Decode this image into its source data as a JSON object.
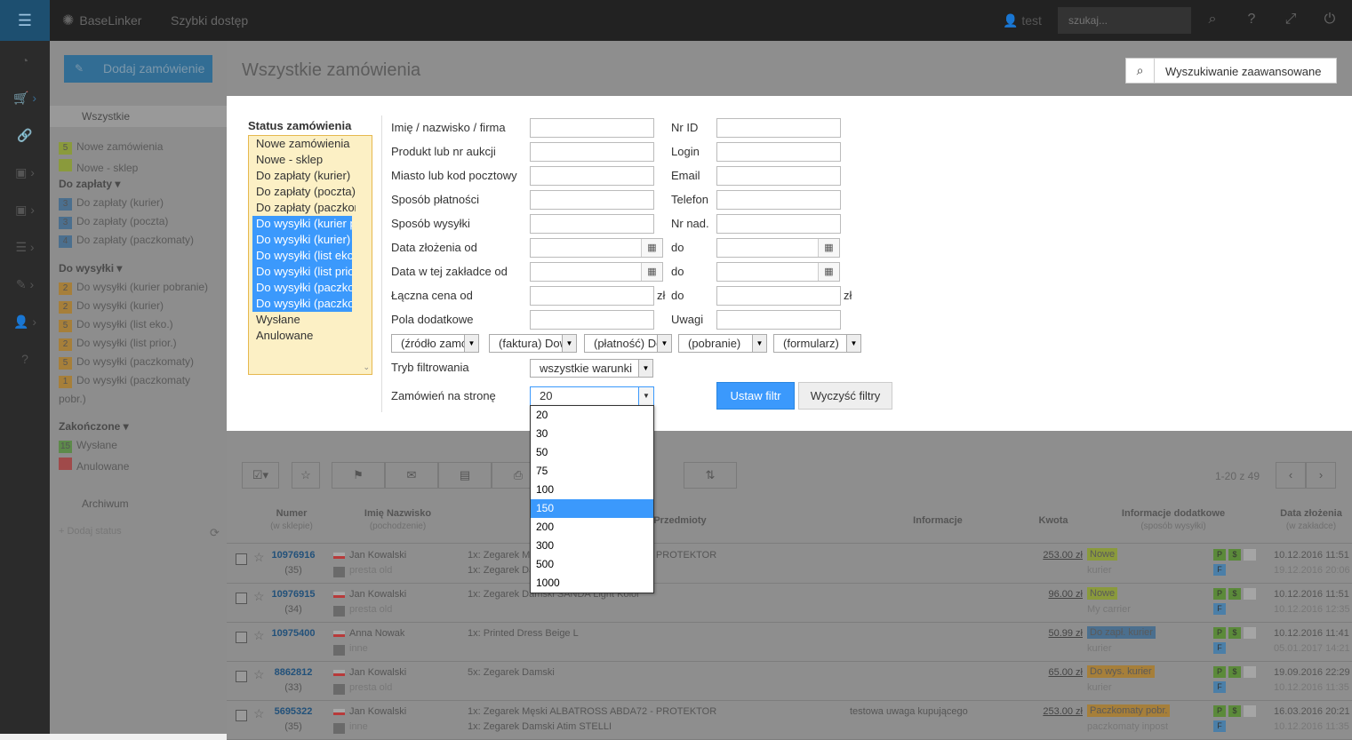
{
  "topbar": {
    "brand": "BaseLinker",
    "quick_access": "Szybki dostęp",
    "user": "test",
    "search_placeholder": "szukaj..."
  },
  "sidebar": {
    "add_order": "Dodaj zamówienie",
    "all": "Wszystkie",
    "items": [
      {
        "num": "5",
        "label": "Nowe zamówienia",
        "color": "#8a9a3c"
      },
      {
        "num": "",
        "label": "Nowe - sklep",
        "color": "#8a9a3c"
      },
      {
        "num": "3",
        "label": "Do zapłaty (kurier)",
        "color": "#4b6f8e"
      },
      {
        "num": "3",
        "label": "Do zapłaty (poczta)",
        "color": "#4b6f8e"
      },
      {
        "num": "4",
        "label": "Do zapłaty (paczkomaty)",
        "color": "#4b6f8e"
      },
      {
        "num": "2",
        "label": "Do wysyłki (kurier pobranie)",
        "color": "#a67f3a"
      },
      {
        "num": "2",
        "label": "Do wysyłki (kurier)",
        "color": "#a67f3a"
      },
      {
        "num": "5",
        "label": "Do wysyłki (list eko.)",
        "color": "#a67f3a"
      },
      {
        "num": "2",
        "label": "Do wysyłki (list prior.)",
        "color": "#a67f3a"
      },
      {
        "num": "5",
        "label": "Do wysyłki (paczkomaty)",
        "color": "#a67f3a"
      },
      {
        "num": "1",
        "label": "Do wysyłki (paczkomaty",
        "color": "#a67f3a"
      },
      {
        "num": "",
        "label": "pobr.)",
        "color": ""
      },
      {
        "num": "15",
        "label": "Wysłane",
        "color": "#5d8a4a"
      },
      {
        "num": "",
        "label": "Anulowane",
        "color": "#a04a4a"
      }
    ],
    "groups": [
      "Do zapłaty ▾",
      "Do wysyłki ▾",
      "Zakończone ▾"
    ],
    "archive": "Archiwum",
    "add_status": "+ Dodaj status"
  },
  "main": {
    "title": "Wszystkie zamówienia",
    "advanced_search": "Wyszukiwanie zaawansowane"
  },
  "filter": {
    "status_label": "Status zamówienia",
    "status_options": [
      {
        "label": "Nowe zamówienia",
        "selected": false
      },
      {
        "label": "Nowe - sklep",
        "selected": false
      },
      {
        "label": "Do zapłaty (kurier)",
        "selected": false
      },
      {
        "label": "Do zapłaty (poczta)",
        "selected": false
      },
      {
        "label": "Do zapłaty (paczkomaty)",
        "selected": false
      },
      {
        "label": "Do wysyłki (kurier pobranie)",
        "selected": true
      },
      {
        "label": "Do wysyłki (kurier)",
        "selected": true
      },
      {
        "label": "Do wysyłki (list eko.)",
        "selected": true
      },
      {
        "label": "Do wysyłki (list prior.)",
        "selected": true
      },
      {
        "label": "Do wysyłki (paczkomaty)",
        "selected": true
      },
      {
        "label": "Do wysyłki (paczkomaty pobr.)",
        "selected": true
      },
      {
        "label": "Wysłane",
        "selected": false
      },
      {
        "label": "Anulowane",
        "selected": false
      }
    ],
    "left_labels": [
      "Imię / nazwisko / firma",
      "Produkt lub nr aukcji",
      "Miasto lub kod pocztowy",
      "Sposób płatności",
      "Sposób wysyłki",
      "Data złożenia od",
      "Data w tej zakładce od",
      "Łączna cena od",
      "Pola dodatkowe"
    ],
    "right_labels": [
      "Nr ID",
      "Login",
      "Email",
      "Telefon",
      "Nr nad.",
      "do",
      "do",
      "do",
      "Uwagi"
    ],
    "currency": "zł",
    "selects": [
      "(źródło zamówienia)",
      "(faktura) Dowolnie",
      "(płatność) Dowolnie",
      "(pobranie)",
      "(formularz)"
    ],
    "mode_label": "Tryb filtrowania",
    "mode_value": "wszystkie warunki",
    "per_page_label": "Zamówień na stronę",
    "per_page_value": "20",
    "per_page_options": [
      "20",
      "30",
      "50",
      "75",
      "100",
      "150",
      "200",
      "300",
      "500",
      "1000"
    ],
    "per_page_highlight": "150",
    "set_filter": "Ustaw filtr",
    "clear_filters": "Wyczyść filtry"
  },
  "toolbar": {
    "count": "1-20 z 49"
  },
  "table": {
    "headers": {
      "number": "Numer",
      "number_sub": "(w sklepie)",
      "name": "Imię Nazwisko",
      "name_sub": "(pochodzenie)",
      "items": "Przedmioty",
      "info": "Informacje",
      "amount": "Kwota",
      "extra": "Informacje dodatkowe",
      "extra_sub": "(sposób wysyłki)",
      "date": "Data złożenia",
      "date_sub": "(w zakładce)"
    },
    "rows": [
      {
        "id": "10976916",
        "count": "(35)",
        "flag": true,
        "customer": "Jan Kowalski",
        "source": "presta old",
        "p1": "1x: Zegarek Męski ALBATROSS ABDA72 - PROTEKTOR",
        "p2": "1x: Zegarek Damski",
        "info": "",
        "amount": "253.00 zł",
        "badge": "Nowe",
        "badge_color": "#8a9a3c",
        "ship": "kurier",
        "d1": "10.12.2016 11:51",
        "d2": "19.12.2016 20:06"
      },
      {
        "id": "10976915",
        "count": "(34)",
        "flag": true,
        "customer": "Jan Kowalski",
        "source": "presta old",
        "p1": "1x: Zegarek Damski SANDA Light Kolor",
        "p2": "",
        "info": "",
        "amount": "96.00 zł",
        "badge": "Nowe",
        "badge_color": "#8a9a3c",
        "ship": "My carrier",
        "d1": "10.12.2016 11:51",
        "d2": "10.12.2016 12:35"
      },
      {
        "id": "10975400",
        "count": "",
        "flag": true,
        "customer": "Anna Nowak",
        "source": "inne",
        "p1": "1x: Printed Dress Beige L",
        "p2": "",
        "info": "",
        "amount": "50.99 zł",
        "badge": "Do zapł. kurier",
        "badge_color": "#4b6f8e",
        "ship": "kurier",
        "d1": "10.12.2016 11:41",
        "d2": "05.01.2017 14:21"
      },
      {
        "id": "8862812",
        "count": "(33)",
        "flag": true,
        "customer": "Jan Kowalski",
        "source": "presta old",
        "p1": "5x: Zegarek Damski",
        "p2": "",
        "info": "",
        "amount": "65.00 zł",
        "badge": "Do wys. kurier",
        "badge_color": "#a67f3a",
        "ship": "kurier",
        "d1": "19.09.2016 22:29",
        "d2": "10.12.2016 11:35"
      },
      {
        "id": "5695322",
        "count": "(35)",
        "flag": true,
        "customer": "Jan Kowalski",
        "source": "inne",
        "p1": "1x: Zegarek Męski ALBATROSS ABDA72 - PROTEKTOR",
        "p2": "1x: Zegarek Damski Atim STELLI",
        "info": "testowa uwaga kupującego",
        "amount": "253.00 zł",
        "badge": "Paczkomaty pobr.",
        "badge_color": "#a67f3a",
        "ship": "paczkomaty inpost",
        "d1": "16.03.2016 20:21",
        "d2": "10.12.2016 11:35"
      }
    ]
  }
}
